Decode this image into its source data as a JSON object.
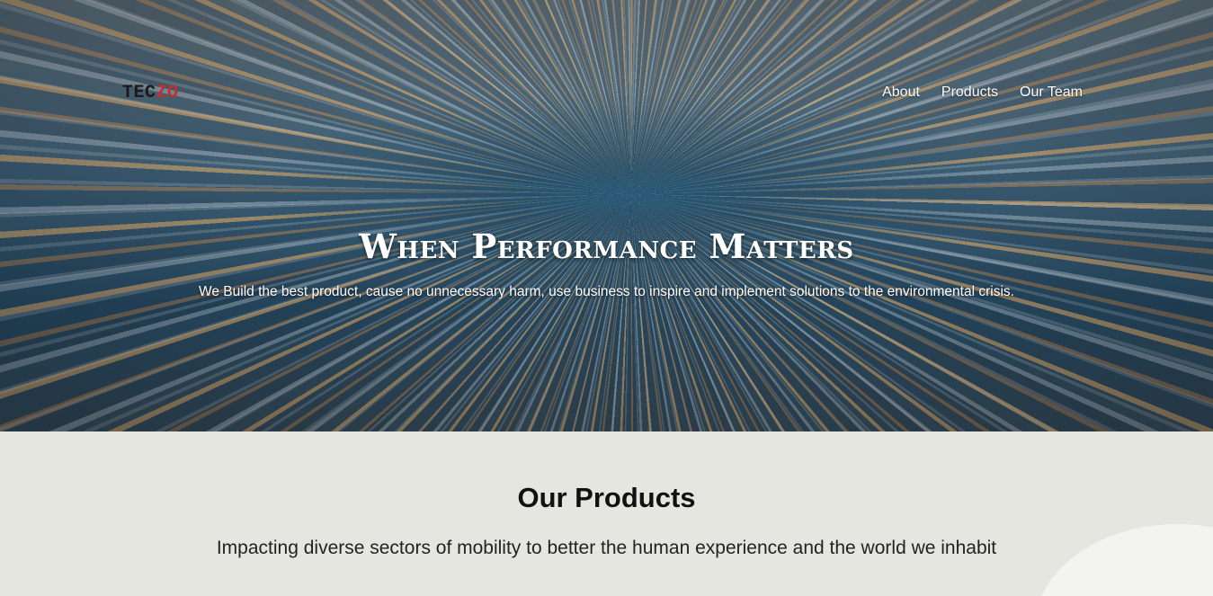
{
  "header": {
    "logo": {
      "part_a": "TEC",
      "part_b": "ZO"
    },
    "nav": [
      {
        "label": "About"
      },
      {
        "label": "Products"
      },
      {
        "label": "Our Team"
      }
    ]
  },
  "hero": {
    "title": "When Performance Matters",
    "subtitle": "We Build the best product, cause no unnecessary harm, use business to inspire and implement solutions to the environmental crisis."
  },
  "products": {
    "title": "Our Products",
    "subtitle": "Impacting diverse sectors of mobility to better the human experience and the world we inhabit"
  },
  "colors": {
    "logo_dark": "#1a1a1a",
    "logo_accent": "#c0302c",
    "section_bg": "#e6e6e1"
  }
}
